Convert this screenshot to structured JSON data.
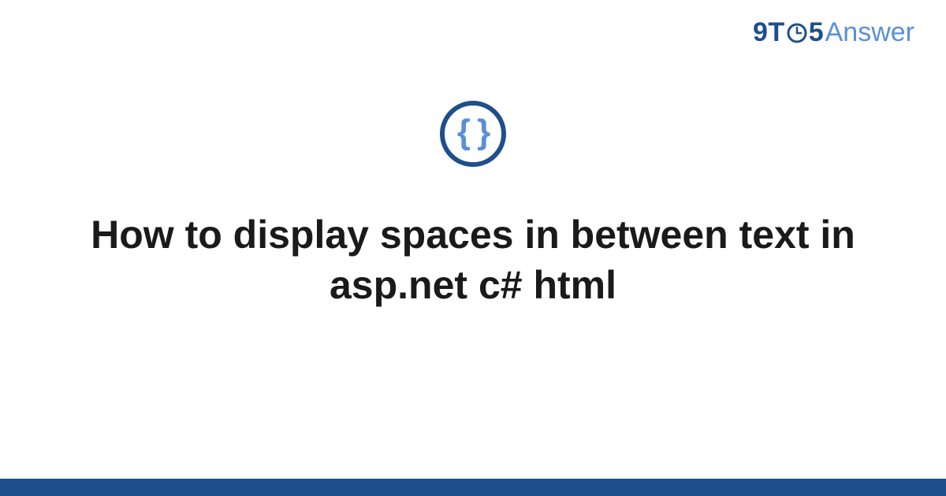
{
  "logo": {
    "part1": "9T",
    "part2": "5",
    "part3": "Answer"
  },
  "badge": {
    "glyph": "{ }"
  },
  "title": "How to display spaces in between text in asp.net c# html",
  "colors": {
    "brand_dark": "#1e4f8a",
    "brand_light": "#5a8fd6",
    "text": "#1a1a1a",
    "bg": "#ffffff"
  }
}
